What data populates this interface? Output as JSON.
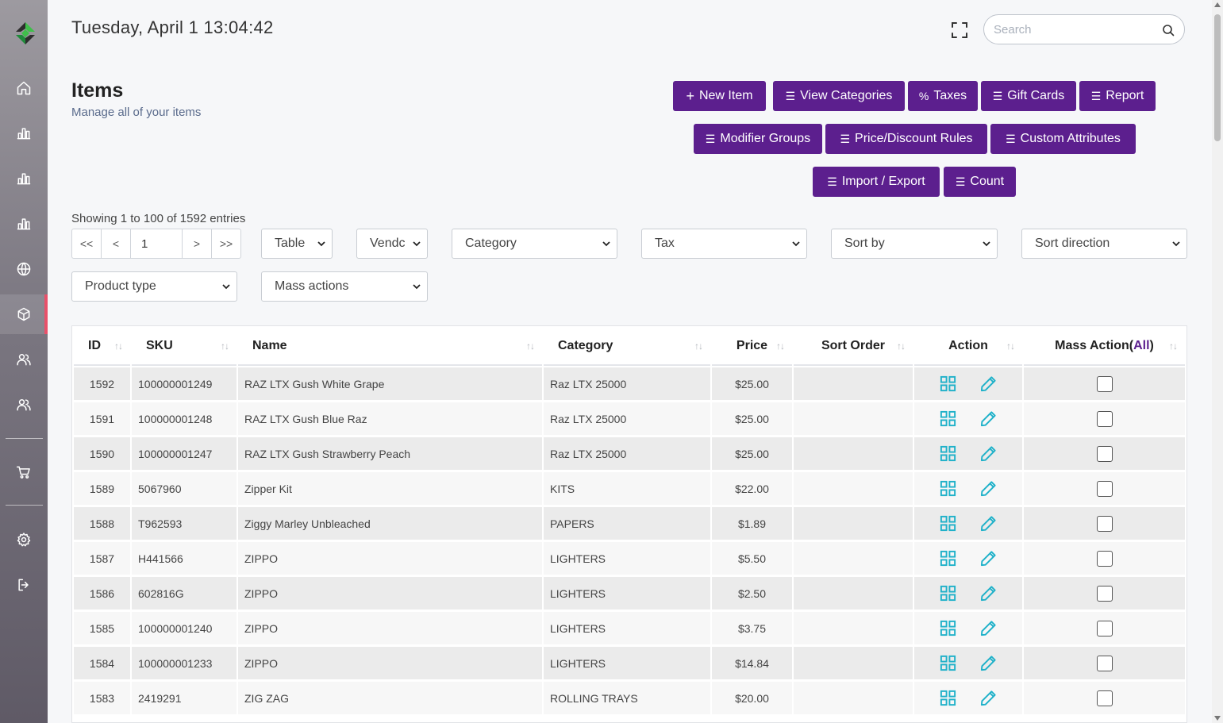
{
  "header": {
    "datetime": "Tuesday, April 1 13:04:42",
    "search_placeholder": "Search"
  },
  "page": {
    "title": "Items",
    "subtitle": "Manage all of your items"
  },
  "toolbar": {
    "new_item": "New Item",
    "view_categories": "View Categories",
    "taxes": "Taxes",
    "gift_cards": "Gift Cards",
    "report": "Report",
    "modifier_groups": "Modifier Groups",
    "price_discount_rules": "Price/Discount Rules",
    "custom_attributes": "Custom Attributes",
    "import_export": "Import / Export",
    "count": "Count"
  },
  "listing": {
    "showing": "Showing 1 to 100 of 1592 entries",
    "first": "<<",
    "prev": "<",
    "page": "1",
    "next": ">",
    "last": ">>"
  },
  "filters": {
    "view": "Table",
    "vendor": "Vendc",
    "category": "Category",
    "tax": "Tax",
    "sort_by": "Sort by",
    "sort_direction": "Sort direction",
    "product_type": "Product type",
    "mass_actions": "Mass actions"
  },
  "table": {
    "columns": {
      "id": "ID",
      "sku": "SKU",
      "name": "Name",
      "category": "Category",
      "price": "Price",
      "sort_order": "Sort Order",
      "action": "Action",
      "mass_action": "Mass Action(",
      "mass_all": "All",
      "mass_close": ")"
    },
    "rows": [
      {
        "id": "1592",
        "sku": "100000001249",
        "name": "RAZ LTX Gush White Grape",
        "category": "Raz LTX 25000",
        "price": "$25.00",
        "sort_order": ""
      },
      {
        "id": "1591",
        "sku": "100000001248",
        "name": "RAZ LTX Gush Blue Raz",
        "category": "Raz LTX 25000",
        "price": "$25.00",
        "sort_order": ""
      },
      {
        "id": "1590",
        "sku": "100000001247",
        "name": "RAZ LTX Gush Strawberry Peach",
        "category": "Raz LTX 25000",
        "price": "$25.00",
        "sort_order": ""
      },
      {
        "id": "1589",
        "sku": "5067960",
        "name": "Zipper Kit",
        "category": "KITS",
        "price": "$22.00",
        "sort_order": ""
      },
      {
        "id": "1588",
        "sku": "T962593",
        "name": "Ziggy Marley Unbleached",
        "category": "PAPERS",
        "price": "$1.89",
        "sort_order": ""
      },
      {
        "id": "1587",
        "sku": "H441566",
        "name": "ZIPPO",
        "category": "LIGHTERS",
        "price": "$5.50",
        "sort_order": ""
      },
      {
        "id": "1586",
        "sku": "602816G",
        "name": "ZIPPO",
        "category": "LIGHTERS",
        "price": "$2.50",
        "sort_order": ""
      },
      {
        "id": "1585",
        "sku": "100000001240",
        "name": "ZIPPO",
        "category": "LIGHTERS",
        "price": "$3.75",
        "sort_order": ""
      },
      {
        "id": "1584",
        "sku": "100000001233",
        "name": "ZIPPO",
        "category": "LIGHTERS",
        "price": "$14.84",
        "sort_order": ""
      },
      {
        "id": "1583",
        "sku": "2419291",
        "name": "ZIG ZAG",
        "category": "ROLLING TRAYS",
        "price": "$20.00",
        "sort_order": ""
      }
    ]
  },
  "colors": {
    "accent": "#5c1f8e",
    "action_icon": "#1fb1c9",
    "sidebar_active": "#e8506a"
  },
  "icons": {
    "sidebar": [
      "home-icon",
      "bar-chart-icon",
      "bar-chart-icon",
      "bar-chart-icon",
      "globe-icon",
      "box-icon",
      "users-icon",
      "users-icon",
      "cart-icon",
      "gear-icon",
      "logout-icon"
    ],
    "row_actions": [
      "grid-icon",
      "pencil-icon"
    ]
  }
}
